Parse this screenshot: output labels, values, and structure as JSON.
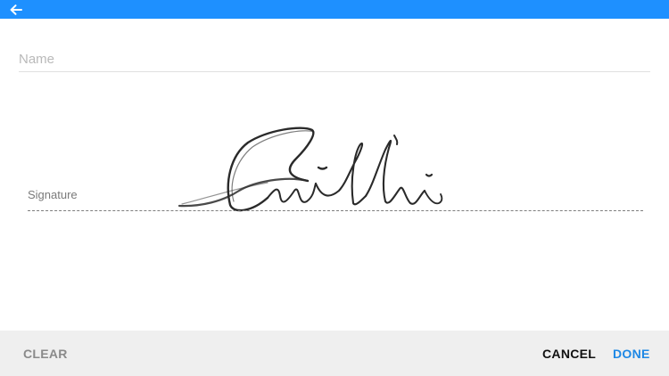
{
  "colors": {
    "topbar": "#1e90ff",
    "done": "#1e88e5",
    "clear": "#8a8a8a",
    "cancel": "#111111",
    "bottombar": "#efefef"
  },
  "header": {
    "back_icon": "arrow-left-icon"
  },
  "form": {
    "name_placeholder": "Name",
    "name_value": "",
    "signature_label": "Signature"
  },
  "actions": {
    "clear_label": "CLEAR",
    "cancel_label": "CANCEL",
    "done_label": "DONE"
  }
}
